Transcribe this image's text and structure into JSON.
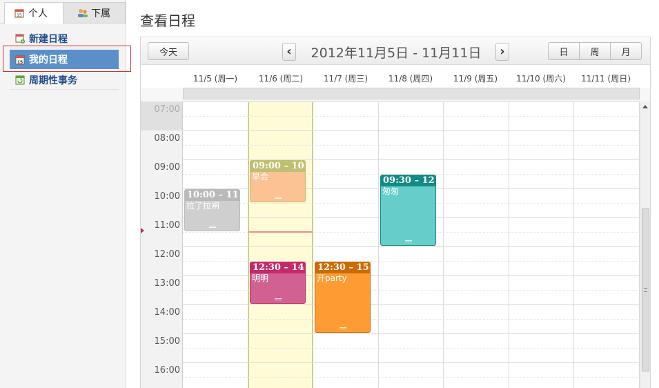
{
  "sidebar": {
    "tabs": [
      {
        "label": "个人",
        "icon": "calendar-15-icon",
        "active": true
      },
      {
        "label": "下属",
        "icon": "people-icon",
        "active": false
      }
    ],
    "items": [
      {
        "label": "新建日程",
        "icon": "calendar-add-icon"
      },
      {
        "label": "我的日程",
        "icon": "calendar-15-icon",
        "active": true
      },
      {
        "label": "周期性事务",
        "icon": "recurring-task-icon"
      }
    ]
  },
  "page_title": "查看日程",
  "toolbar": {
    "today_label": "今天",
    "prev_label": "‹",
    "next_label": "›",
    "date_range": "2012年11月5日 - 11月11日",
    "views": [
      "日",
      "周",
      "月"
    ]
  },
  "columns": [
    "11/5 (周一)",
    "11/6 (周二)",
    "11/7 (周三)",
    "11/8 (周四)",
    "11/9 (周五)",
    "11/10 (周六)",
    "11/11 (周日)"
  ],
  "today_column": 1,
  "time_labels": [
    "07:00",
    "08:00",
    "09:00",
    "10:00",
    "11:00",
    "12:00",
    "13:00",
    "14:00",
    "15:00",
    "16:00"
  ],
  "events": [
    {
      "day": 0,
      "start": "10:00",
      "end": "11:30",
      "time_label": "10:00 – 11:",
      "title": "拉了拉闸",
      "color": "#cfcfcf",
      "header_color": "#b9b9b9"
    },
    {
      "day": 1,
      "start": "09:00",
      "end": "10:30",
      "time_label": "09:00 – 10:",
      "title": "早会",
      "color": "#fdc293",
      "header_color": "#bfbf72"
    },
    {
      "day": 1,
      "start": "12:30",
      "end": "14:00",
      "time_label": "12:30 – 14:",
      "title": "明明",
      "color": "#d06191",
      "header_color": "#c42a6b"
    },
    {
      "day": 2,
      "start": "12:30",
      "end": "15:00",
      "time_label": "12:30 – 15:",
      "title": "开party",
      "color": "#ff9b33",
      "header_color": "#cc6b00"
    },
    {
      "day": 3,
      "start": "09:30",
      "end": "12:00",
      "time_label": "09:30 – 12:",
      "title": "匆匆",
      "color": "#66cdcb",
      "header_color": "#138a86"
    }
  ]
}
